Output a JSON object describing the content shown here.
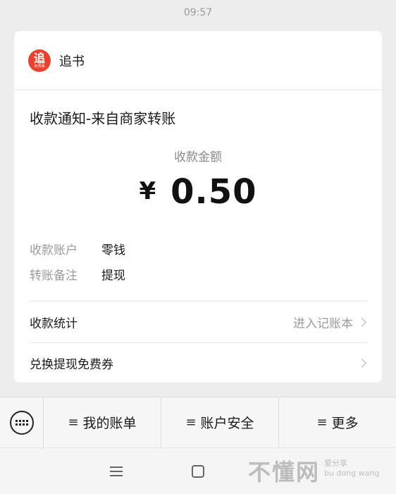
{
  "timestamp": "09:57",
  "app": {
    "name": "追书",
    "logo_glyph": "追",
    "logo_sub": "免费版",
    "logo_color": "#e8432e"
  },
  "notice": {
    "title": "收款通知-来自商家转账",
    "amount_label": "收款金额",
    "currency": "¥",
    "amount": "0.50",
    "details": [
      {
        "key": "收款账户",
        "value": "零钱"
      },
      {
        "key": "转账备注",
        "value": "提现"
      }
    ],
    "stats_label": "收款统计",
    "stats_link": "进入记账本",
    "coupon_label": "兑换提现免费券"
  },
  "menu": {
    "keyboard_icon": "keyboard-icon",
    "items": [
      {
        "label": "我的账单"
      },
      {
        "label": "账户安全"
      },
      {
        "label": "更多"
      }
    ]
  },
  "watermark": {
    "big": "不懂网",
    "line1": "爱分享",
    "line2": "bu dong wang"
  }
}
